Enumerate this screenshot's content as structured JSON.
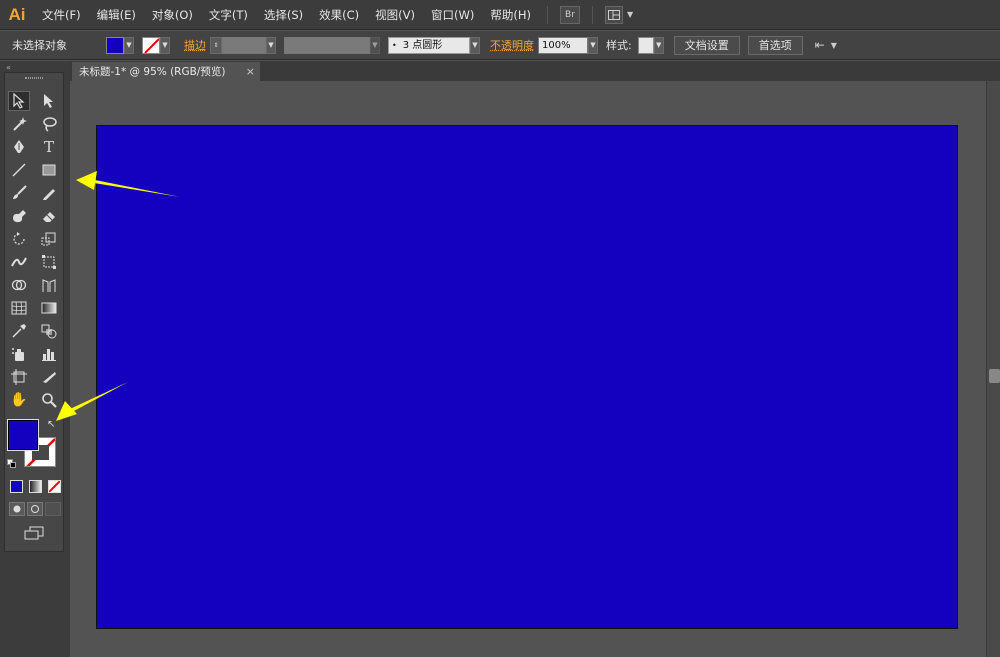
{
  "app": {
    "logo": "Ai"
  },
  "menu": [
    "文件(F)",
    "编辑(E)",
    "对象(O)",
    "文字(T)",
    "选择(S)",
    "效果(C)",
    "视图(V)",
    "窗口(W)",
    "帮助(H)"
  ],
  "menubar_buttons": {
    "bridge": "Br"
  },
  "control_bar": {
    "selection_status": "未选择对象",
    "stroke_label": "描边",
    "brush_value": "3 点圆形",
    "opacity_label": "不透明度",
    "opacity_value": "100%",
    "style_label": "样式",
    "doc_setup_button": "文档设置",
    "preferences_button": "首选项"
  },
  "document": {
    "tab_title": "未标题-1* @ 95% (RGB/预览)",
    "tab_close": "×"
  },
  "colors": {
    "fill": "#1400bf",
    "artboard_fill": "#1400bf",
    "annotation_arrow": "#ffff00",
    "accent": "#f7a531"
  },
  "tools": [
    "selection-icon",
    "direct-selection-icon",
    "magic-wand-icon",
    "lasso-icon",
    "pen-icon",
    "type-icon",
    "line-segment-icon",
    "rectangle-icon",
    "paintbrush-icon",
    "pencil-icon",
    "blob-brush-icon",
    "eraser-icon",
    "rotate-icon",
    "scale-icon",
    "width-icon",
    "free-transform-icon",
    "shape-builder-icon",
    "perspective-grid-icon",
    "mesh-icon",
    "gradient-icon",
    "eyedropper-icon",
    "blend-icon",
    "symbol-sprayer-icon",
    "column-graph-icon",
    "artboard-icon",
    "slice-icon",
    "hand-icon",
    "zoom-icon"
  ],
  "tool_glyphs": {
    "type": "T",
    "swap": "↖",
    "hand": "✋"
  }
}
